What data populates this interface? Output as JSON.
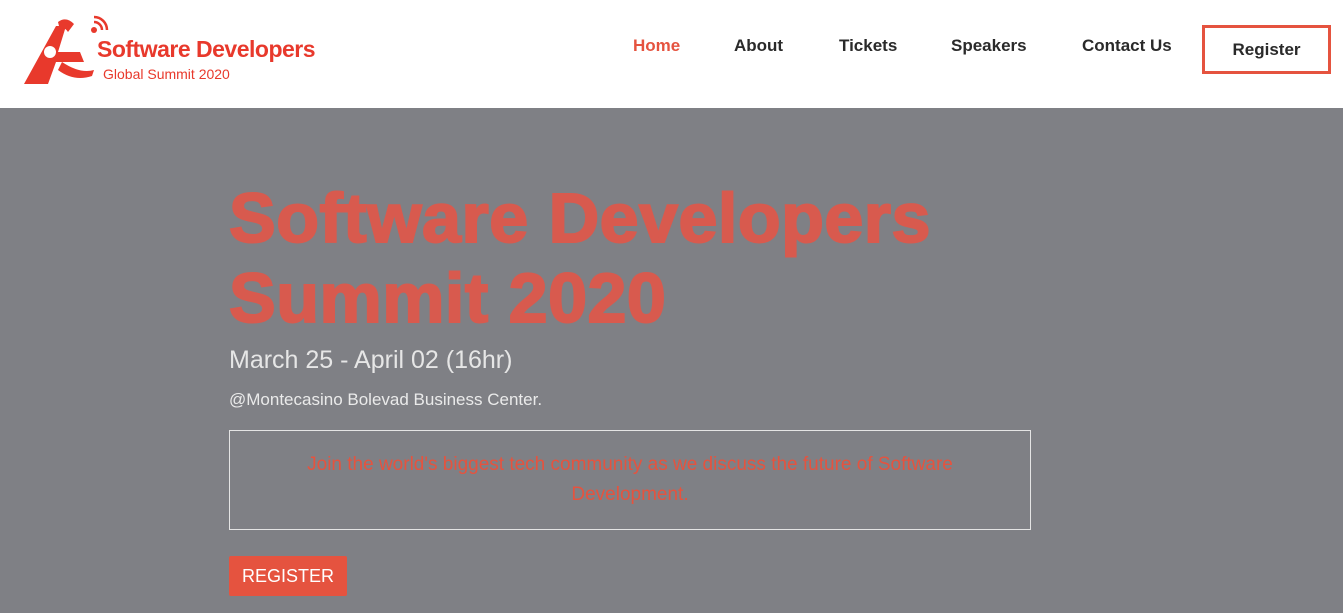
{
  "logo": {
    "title": "Software Developers",
    "subtitle": "Global Summit 2020",
    "icon": "runner-signal-icon",
    "color": "#e8392c"
  },
  "nav": {
    "items": [
      {
        "label": "Home",
        "active": true
      },
      {
        "label": "About",
        "active": false
      },
      {
        "label": "Tickets",
        "active": false
      },
      {
        "label": "Speakers",
        "active": false
      },
      {
        "label": "Contact Us",
        "active": false
      }
    ],
    "register_label": "Register"
  },
  "hero": {
    "title_line1": "Software Developers",
    "title_line2": "Summit 2020",
    "date": "March 25 - April 02 (16hr)",
    "venue": "@Montecasino Bolevad Business Center.",
    "tagline": "Join the world's biggest tech community as we discuss the future of Software Development.",
    "register_label": "REGISTER"
  },
  "colors": {
    "accent": "#e5533f",
    "hero_bg": "#7f8085",
    "nav_text": "#2a2a2a"
  }
}
